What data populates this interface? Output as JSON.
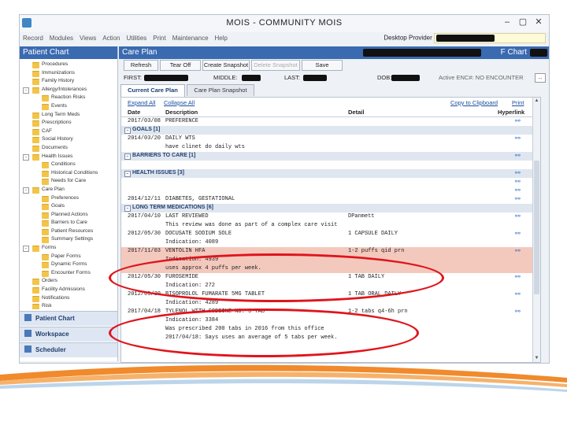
{
  "window": {
    "title": "MOIS - COMMUNITY MOIS",
    "controls": [
      "–",
      "▢",
      "✕"
    ]
  },
  "menu": [
    "Record",
    "Modules",
    "Views",
    "Action",
    "Utilities",
    "Print",
    "Maintenance",
    "Help"
  ],
  "provider_label": "Desktop Provider",
  "left": {
    "header": "Patient Chart",
    "tree": [
      {
        "label": "Procedures",
        "level": 1,
        "exp": ""
      },
      {
        "label": "Immunizations",
        "level": 1,
        "exp": ""
      },
      {
        "label": "Family History",
        "level": 1,
        "exp": ""
      },
      {
        "label": "Allergy/Intolerances",
        "level": 1,
        "exp": "−"
      },
      {
        "label": "Reaction Risks",
        "level": 2,
        "exp": ""
      },
      {
        "label": "Events",
        "level": 2,
        "exp": ""
      },
      {
        "label": "Long Term Meds",
        "level": 1,
        "exp": ""
      },
      {
        "label": "Prescriptions",
        "level": 1,
        "exp": ""
      },
      {
        "label": "CAF",
        "level": 1,
        "exp": ""
      },
      {
        "label": "Social History",
        "level": 1,
        "exp": ""
      },
      {
        "label": "Documents",
        "level": 1,
        "exp": ""
      },
      {
        "label": "Health Issues",
        "level": 1,
        "exp": "−"
      },
      {
        "label": "Conditions",
        "level": 2,
        "exp": ""
      },
      {
        "label": "Historical Conditions",
        "level": 2,
        "exp": ""
      },
      {
        "label": "Needs for Care",
        "level": 2,
        "exp": ""
      },
      {
        "label": "Care Plan",
        "level": 1,
        "exp": "−"
      },
      {
        "label": "Preferences",
        "level": 2,
        "exp": ""
      },
      {
        "label": "Goals",
        "level": 2,
        "exp": ""
      },
      {
        "label": "Planned Actions",
        "level": 2,
        "exp": ""
      },
      {
        "label": "Barriers to Care",
        "level": 2,
        "exp": ""
      },
      {
        "label": "Patient Resources",
        "level": 2,
        "exp": ""
      },
      {
        "label": "Summary Settings",
        "level": 2,
        "exp": ""
      },
      {
        "label": "Forms",
        "level": 1,
        "exp": "−"
      },
      {
        "label": "Paper Forms",
        "level": 2,
        "exp": ""
      },
      {
        "label": "Dynamic Forms",
        "level": 2,
        "exp": ""
      },
      {
        "label": "Encounter Forms",
        "level": 2,
        "exp": ""
      },
      {
        "label": "Orders",
        "level": 1,
        "exp": ""
      },
      {
        "label": "Facility Admissions",
        "level": 1,
        "exp": ""
      },
      {
        "label": "Notifications",
        "level": 1,
        "exp": ""
      },
      {
        "label": "Risk",
        "level": 1,
        "exp": ""
      }
    ],
    "nav": [
      "Patient Chart",
      "Workspace",
      "Scheduler"
    ]
  },
  "right": {
    "header": "Care Plan",
    "chart_label": "Chart",
    "toolbar": [
      {
        "label": "Refresh",
        "disabled": false
      },
      {
        "label": "Tear Off",
        "disabled": false
      },
      {
        "label": "Create Snapshot",
        "disabled": false
      },
      {
        "label": "Delete Snapshot",
        "disabled": true
      },
      {
        "label": "Save",
        "disabled": false
      }
    ],
    "patient": {
      "first": "FIRST:",
      "middle": "MIDDLE:",
      "last": "LAST:",
      "dob": "DOB:",
      "encounter": "Active ENC#: NO ENCOUNTER",
      "dots": "..."
    },
    "tabs": [
      "Current Care Plan",
      "Care Plan Snapshot"
    ],
    "links": {
      "expand": "Expand All",
      "collapse": "Collapse All",
      "copy": "Copy to Clipboard",
      "print": "Print"
    },
    "columns": [
      "Date",
      "Description",
      "Detail",
      "Hyperlink"
    ],
    "rows": [
      {
        "type": "data",
        "date": "2017/03/08",
        "desc": "PREFERENCE",
        "detail": "",
        "link": true
      },
      {
        "type": "group",
        "desc": "GOALS   [1]",
        "link": false
      },
      {
        "type": "data",
        "date": "2014/03/20",
        "desc": "DAILY WTS",
        "detail": "",
        "link": true
      },
      {
        "type": "data",
        "date": "",
        "desc": "have clinet do daily wts",
        "detail": "",
        "link": false
      },
      {
        "type": "group",
        "desc": "BARRIERS TO CARE   [1]",
        "link": true
      },
      {
        "type": "data",
        "date": "",
        "desc": "",
        "detail": "",
        "link": false
      },
      {
        "type": "group",
        "desc": "HEALTH ISSUES   [3]",
        "link": true
      },
      {
        "type": "data",
        "date": "",
        "desc": "",
        "detail": "",
        "link": true
      },
      {
        "type": "data",
        "date": "",
        "desc": "",
        "detail": "",
        "link": true
      },
      {
        "type": "data",
        "date": "2014/12/11",
        "desc": "DIABETES, GESTATIONAL",
        "detail": "",
        "link": true
      },
      {
        "type": "group",
        "desc": "LONG TERM MEDICATIONS   [6]",
        "link": false
      },
      {
        "type": "data",
        "date": "2017/04/10",
        "desc": "LAST REVIEWED",
        "detail": "DPanmett",
        "link": true
      },
      {
        "type": "data",
        "date": "",
        "desc": "This review was done as part of a complex care visit",
        "detail": "",
        "link": false
      },
      {
        "type": "data",
        "date": "2012/05/30",
        "desc": "DOCUSATE SODIUM SOLE",
        "detail": "1 CAPSULE DAILY",
        "link": true
      },
      {
        "type": "data",
        "date": "",
        "desc": "Indication: 4089",
        "detail": "",
        "link": false
      },
      {
        "type": "hl",
        "date": "2017/11/03",
        "desc": "VENTOLIN HFA",
        "detail": "1-2 puffs qid prn",
        "link": true
      },
      {
        "type": "hl",
        "date": "",
        "desc": "Indication: 4939",
        "detail": "",
        "link": false
      },
      {
        "type": "hl",
        "date": "",
        "desc": "uses approx 4 puffs per week.",
        "detail": "",
        "link": false
      },
      {
        "type": "data",
        "date": "2012/05/30",
        "desc": "FUROSEMIDE",
        "detail": "1 TAB DAILY",
        "link": true
      },
      {
        "type": "data",
        "date": "",
        "desc": "Indication: 272",
        "detail": "",
        "link": false
      },
      {
        "type": "data",
        "date": "2012/05/30",
        "desc": "BISOPROLOL FUMARATE 5MG TABLET",
        "detail": "1 TAB ORAL DAILY",
        "link": true
      },
      {
        "type": "data",
        "date": "",
        "desc": "Indication: 4289",
        "detail": "",
        "link": false
      },
      {
        "type": "data",
        "date": "2017/04/18",
        "desc": "TYLENOL WITH CODEINE NO. 3 TAB",
        "detail": "1-2 tabs q4-6h prn",
        "link": true
      },
      {
        "type": "data",
        "date": "",
        "desc": "Indication: 3384",
        "detail": "",
        "link": false
      },
      {
        "type": "data",
        "date": "",
        "desc": "Was prescribed 200 tabs in 2016 from this office",
        "detail": "",
        "link": false
      },
      {
        "type": "data",
        "date": "",
        "desc": "2017/04/18: Says uses an average of 5 tabs per week.",
        "detail": "",
        "link": false
      }
    ]
  },
  "colors": {
    "header_blue": "#3a6ab0",
    "highlight": "#f4c9bd",
    "annotation_red": "#e0141c",
    "swoosh_orange": "#f08a2c",
    "swoosh_blue": "#3f86c6"
  }
}
